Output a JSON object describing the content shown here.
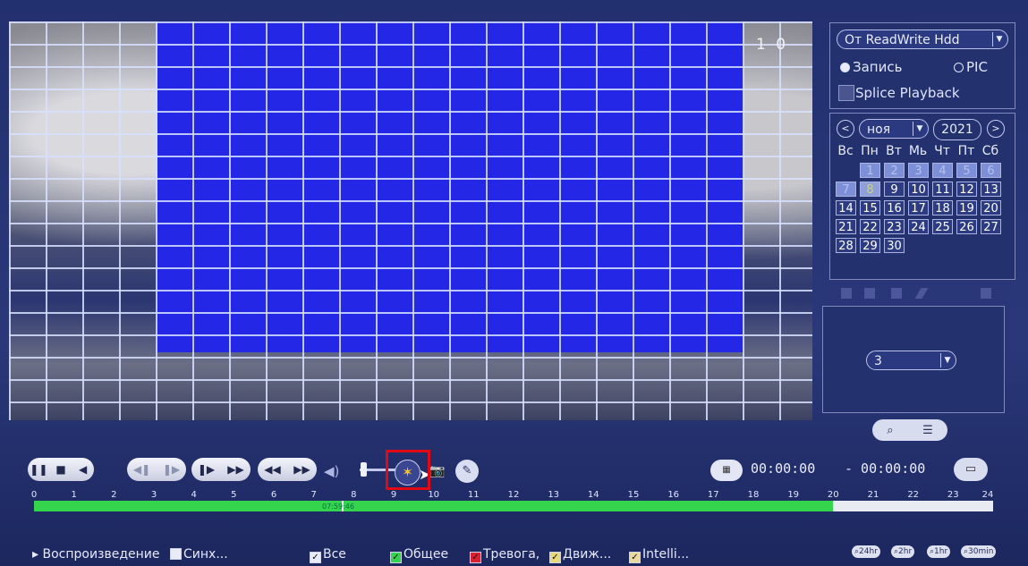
{
  "video": {
    "channel_label": "1 0"
  },
  "source": {
    "selected": "От ReadWrite Hdd",
    "record_label": "Запись",
    "pic_label": "PIC",
    "splice_label": "Splice Playback"
  },
  "calendar": {
    "month": "ноя",
    "year": "2021",
    "prev_label": "<",
    "next_label": ">",
    "weekdays": [
      "Вс",
      "Пн",
      "Вт",
      "Мь",
      "Чт",
      "Пт",
      "Сб"
    ],
    "days": [
      "1",
      "2",
      "3",
      "4",
      "5",
      "6",
      "7",
      "8",
      "9",
      "10",
      "11",
      "12",
      "13",
      "14",
      "15",
      "16",
      "17",
      "18",
      "19",
      "20",
      "21",
      "22",
      "23",
      "24",
      "25",
      "26",
      "27",
      "28",
      "29",
      "30"
    ]
  },
  "channel_select": {
    "value": "3"
  },
  "times": {
    "start": "00:00:00",
    "end": "- 00:00:00"
  },
  "timeline": {
    "ticks": [
      "0",
      "1",
      "2",
      "3",
      "4",
      "5",
      "6",
      "7",
      "8",
      "9",
      "10",
      "11",
      "12",
      "13",
      "14",
      "15",
      "16",
      "17",
      "18",
      "19",
      "20",
      "21",
      "22",
      "23",
      "24"
    ],
    "current_time": "07:59:46",
    "recorded_until_hour": 20
  },
  "bottom": {
    "playback_label": "Воспроизведение",
    "sync_label": "Синх...",
    "all_label": "Все",
    "general_label": "Общее",
    "alarm_label": "Тревога,",
    "motion_label": "Движ...",
    "intelli_label": "Intelli...",
    "zoom_labels": [
      "24hr",
      "2hr",
      "1hr",
      "30min"
    ]
  },
  "colors": {
    "accent_green": "#35d44d",
    "highlight_red": "#e00914",
    "mask_blue": "#2427e6",
    "alarm_red": "#d8212e"
  }
}
